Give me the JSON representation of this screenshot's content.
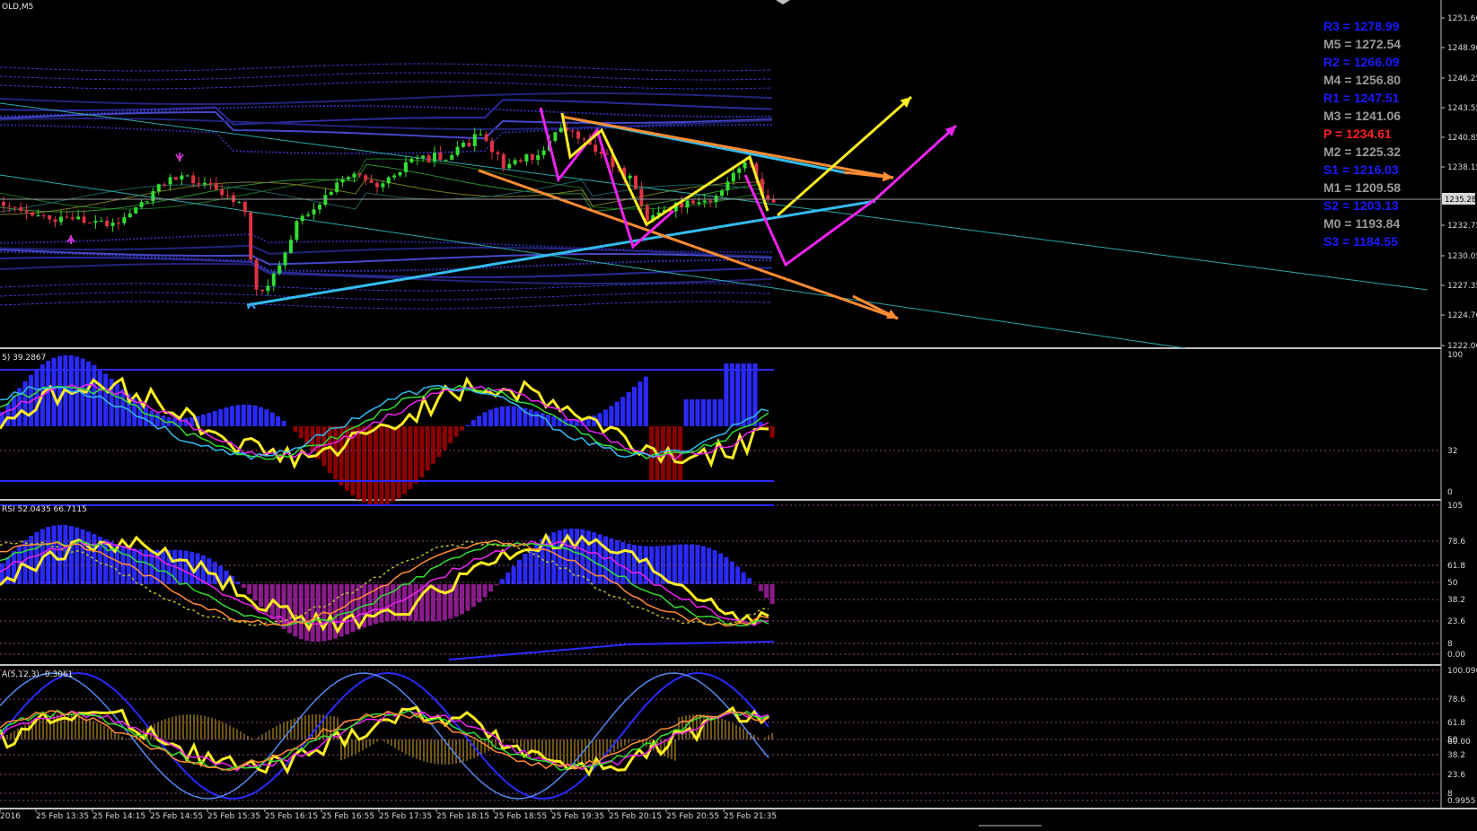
{
  "window": {
    "symbol_label": "OLD,M5"
  },
  "colors": {
    "background": "#000000",
    "bull_candle": "#33dd33",
    "bear_candle": "#dd3344",
    "pivot_blue": "#1a1aff",
    "pivot_grey": "#9a9a9a",
    "pivot_red": "#ff2020",
    "macd_blue": "#2a2aff",
    "macd_red": "#8b0000",
    "rsi_purple": "#8b1a8b"
  },
  "pivots": [
    {
      "text": "R3 = 1278.99",
      "color": "#1a1aff"
    },
    {
      "text": "M5 = 1272.54",
      "color": "#9a9a9a"
    },
    {
      "text": "R2 = 1266.09",
      "color": "#1a1aff"
    },
    {
      "text": "M4 = 1256.80",
      "color": "#9a9a9a"
    },
    {
      "text": "R1 = 1247.51",
      "color": "#1a1aff"
    },
    {
      "text": "M3 = 1241.06",
      "color": "#9a9a9a"
    },
    {
      "text": "P   = 1234.61",
      "color": "#ff2020"
    },
    {
      "text": "M2 = 1225.32",
      "color": "#9a9a9a"
    },
    {
      "text": "S1 = 1216.03",
      "color": "#1a1aff"
    },
    {
      "text": "M1 = 1209.58",
      "color": "#9a9a9a"
    },
    {
      "text": "S2 = 1203.13",
      "color": "#1a1aff"
    },
    {
      "text": "M0 = 1193.84",
      "color": "#9a9a9a"
    },
    {
      "text": "S3 = 1184.55",
      "color": "#1a1aff"
    }
  ],
  "price_axis": {
    "ticks": [
      "1251.60",
      "1248.90",
      "1246.25",
      "1243.55",
      "1240.85",
      "1238.15",
      "1232.75",
      "1230.05",
      "1227.35",
      "1224.70",
      "1222.00"
    ],
    "current_price": "1235.28"
  },
  "panels": {
    "macd_label": "5) 39.2867",
    "macd_ticks": [
      "100",
      "32",
      "0"
    ],
    "rsi_label": "RSI 52.0435 66.7115",
    "rsi_ticks": [
      "105",
      "78.6",
      "61.8",
      "50",
      "38.2",
      "23.6",
      "8",
      "0.00"
    ],
    "stoch_label": "A(5,12,3) -0.3061",
    "stoch_ticks": [
      "100.0969",
      "78.6",
      "61.8",
      "50",
      "38.2",
      "23.6",
      "8",
      "0.9955"
    ],
    "stoch_extra_ticks": [
      "60.00"
    ]
  },
  "time_axis": {
    "labels": [
      "2016",
      "25 Feb 13:35",
      "25 Feb 14:15",
      "25 Feb 14:55",
      "25 Feb 15:35",
      "25 Feb 16:15",
      "25 Feb 16:55",
      "25 Feb 17:35",
      "25 Feb 18:15",
      "25 Feb 18:55",
      "25 Feb 19:35",
      "25 Feb 20:15",
      "25 Feb 20:55",
      "25 Feb 21:35"
    ]
  }
}
